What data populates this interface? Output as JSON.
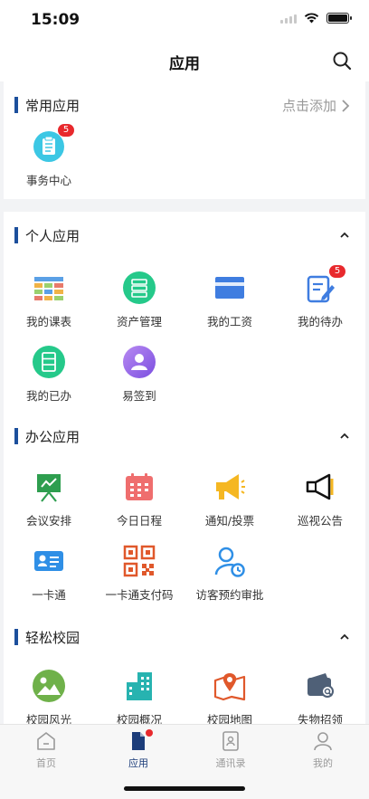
{
  "status": {
    "time": "15:09"
  },
  "header": {
    "title": "应用",
    "search_icon": "search-icon"
  },
  "colors": {
    "accent": "#1c4f9c",
    "badge": "#e8292d",
    "tab_active": "#1c3d7a"
  },
  "favorites": {
    "title": "常用应用",
    "add_label": "点击添加",
    "apps": [
      {
        "label": "事务中心",
        "badge": "5",
        "icon": "document-icon"
      }
    ]
  },
  "personal": {
    "title": "个人应用",
    "apps": [
      {
        "label": "我的课表",
        "icon": "schedule-table-icon"
      },
      {
        "label": "资产管理",
        "icon": "server-icon"
      },
      {
        "label": "我的工资",
        "icon": "card-icon"
      },
      {
        "label": "我的待办",
        "badge": "5",
        "icon": "todo-edit-icon"
      },
      {
        "label": "我的已办",
        "icon": "done-list-icon"
      },
      {
        "label": "易签到",
        "icon": "signin-user-icon"
      }
    ]
  },
  "office": {
    "title": "办公应用",
    "apps": [
      {
        "label": "会议安排",
        "icon": "meeting-board-icon"
      },
      {
        "label": "今日日程",
        "icon": "calendar-icon"
      },
      {
        "label": "通知/投票",
        "icon": "megaphone-icon"
      },
      {
        "label": "巡视公告",
        "icon": "announce-icon"
      },
      {
        "label": "一卡通",
        "icon": "id-card-icon"
      },
      {
        "label": "一卡通支付码",
        "icon": "qr-code-icon"
      },
      {
        "label": "访客预约审批",
        "icon": "visitor-clock-icon"
      }
    ]
  },
  "campus": {
    "title": "轻松校园",
    "apps": [
      {
        "label": "校园风光",
        "icon": "landscape-icon"
      },
      {
        "label": "校园概况",
        "icon": "buildings-icon"
      },
      {
        "label": "校园地图",
        "icon": "map-pin-icon"
      },
      {
        "label": "失物招领",
        "icon": "wallet-search-icon"
      }
    ]
  },
  "tabs": [
    {
      "label": "首页",
      "icon": "home-icon"
    },
    {
      "label": "应用",
      "icon": "apps-document-icon",
      "active": true
    },
    {
      "label": "通讯录",
      "icon": "contacts-icon"
    },
    {
      "label": "我的",
      "icon": "profile-icon"
    }
  ]
}
